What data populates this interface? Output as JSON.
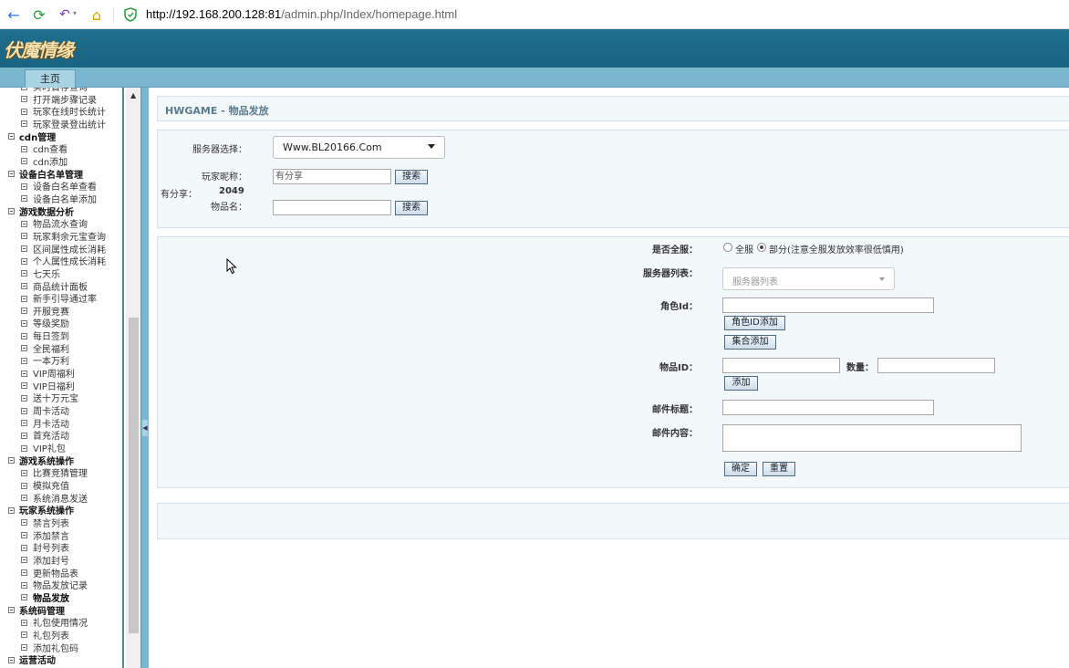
{
  "browser": {
    "url_host": "http://192.168.200.128:81",
    "url_path": "/admin.php/Index/homepage.html"
  },
  "banner": {
    "logo_text": "伏魔情缘"
  },
  "tabs": [
    {
      "label": "主页"
    }
  ],
  "sidebar": {
    "rows": [
      {
        "type": "item",
        "label": "实时首存查询"
      },
      {
        "type": "item",
        "label": "打开端步骤记录"
      },
      {
        "type": "item",
        "label": "玩家在线时长统计"
      },
      {
        "type": "item",
        "label": "玩家登录登出统计"
      },
      {
        "type": "group",
        "label": "cdn管理"
      },
      {
        "type": "item",
        "label": "cdn查看"
      },
      {
        "type": "item",
        "label": "cdn添加"
      },
      {
        "type": "group",
        "label": "设备白名单管理"
      },
      {
        "type": "item",
        "label": "设备白名单查看"
      },
      {
        "type": "item",
        "label": "设备白名单添加"
      },
      {
        "type": "group",
        "label": "游戏数据分析"
      },
      {
        "type": "item",
        "label": "物品流水查询"
      },
      {
        "type": "item",
        "label": "玩家剩余元宝查询"
      },
      {
        "type": "item",
        "label": "区间属性成长消耗"
      },
      {
        "type": "item",
        "label": "个人属性成长消耗"
      },
      {
        "type": "item",
        "label": "七天乐"
      },
      {
        "type": "item",
        "label": "商品统计面板"
      },
      {
        "type": "item",
        "label": "新手引导通过率"
      },
      {
        "type": "item",
        "label": "开服竞赛"
      },
      {
        "type": "item",
        "label": "等级奖励"
      },
      {
        "type": "item",
        "label": "每日签到"
      },
      {
        "type": "item",
        "label": "全民福利"
      },
      {
        "type": "item",
        "label": "一本万利"
      },
      {
        "type": "item",
        "label": "VIP周福利"
      },
      {
        "type": "item",
        "label": "VIP日福利"
      },
      {
        "type": "item",
        "label": "送十万元宝"
      },
      {
        "type": "item",
        "label": "周卡活动"
      },
      {
        "type": "item",
        "label": "月卡活动"
      },
      {
        "type": "item",
        "label": "首充活动"
      },
      {
        "type": "item",
        "label": "VIP礼包"
      },
      {
        "type": "group",
        "label": "游戏系统操作"
      },
      {
        "type": "item",
        "label": "比赛竞猜管理"
      },
      {
        "type": "item",
        "label": "模拟充值"
      },
      {
        "type": "item",
        "label": "系统消息发送"
      },
      {
        "type": "group",
        "label": "玩家系统操作"
      },
      {
        "type": "item",
        "label": "禁言列表"
      },
      {
        "type": "item",
        "label": "添加禁言"
      },
      {
        "type": "item",
        "label": "封号列表"
      },
      {
        "type": "item",
        "label": "添加封号"
      },
      {
        "type": "item",
        "label": "更新物品表"
      },
      {
        "type": "item",
        "label": "物品发放记录"
      },
      {
        "type": "item",
        "label": "物品发放",
        "active": true
      },
      {
        "type": "group",
        "label": "系统码管理"
      },
      {
        "type": "item",
        "label": "礼包使用情况"
      },
      {
        "type": "item",
        "label": "礼包列表"
      },
      {
        "type": "item",
        "label": "添加礼包码"
      },
      {
        "type": "group",
        "label": "运营活动"
      }
    ]
  },
  "main": {
    "page_title": "HWGAME - 物品发放",
    "search": {
      "server_label": "服务器选择：",
      "server_value": "Www.BL20166.Com",
      "nickname_label": "玩家昵称：",
      "nickname_value": "有分享",
      "search_btn": "搜索",
      "result_label": "有分享：",
      "result_value": "2049",
      "item_name_label": "物品名：",
      "item_name_value": "",
      "search_btn2": "搜索"
    },
    "form": {
      "all_server_label": "是否全服：",
      "opt_all": "全服",
      "opt_part": "部分(注意全服发放效率很低慎用)",
      "server_list_label": "服务器列表：",
      "server_list_placeholder": "服务器列表",
      "role_id_label": "角色Id：",
      "role_id_value": "",
      "role_add_btn": "角色ID添加",
      "set_add_btn": "集合添加",
      "item_id_label": "物品ID：",
      "item_id_value": "",
      "qty_label": "数量：",
      "qty_value": "",
      "add_btn": "添加",
      "mail_title_label": "邮件标题：",
      "mail_title_value": "",
      "mail_content_label": "邮件内容：",
      "mail_content_value": "",
      "confirm_btn": "确定",
      "reset_btn": "重置"
    }
  },
  "colors": {
    "banner": "#1f6f8e",
    "tabstrip": "#7ab7cf",
    "panel_bg": "#f3f8fb"
  }
}
